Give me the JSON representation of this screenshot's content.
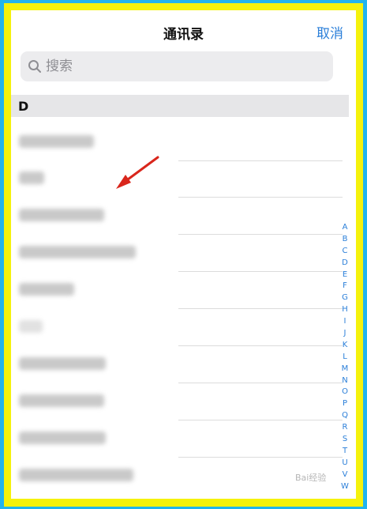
{
  "header": {
    "title": "通讯录",
    "cancel_label": "取消"
  },
  "search": {
    "placeholder": "搜索"
  },
  "section": {
    "letter": "D"
  },
  "contacts": [
    {
      "label": ""
    },
    {
      "label": ""
    },
    {
      "label": ""
    },
    {
      "label": ""
    },
    {
      "label": ""
    },
    {
      "label": ""
    },
    {
      "label": ""
    },
    {
      "label": ""
    },
    {
      "label": ""
    },
    {
      "label": ""
    }
  ],
  "index_letters": [
    "A",
    "B",
    "C",
    "D",
    "E",
    "F",
    "G",
    "H",
    "I",
    "J",
    "K",
    "L",
    "M",
    "N",
    "O",
    "P",
    "Q",
    "R",
    "S",
    "T",
    "U",
    "V",
    "W"
  ],
  "watermark": "Bai经验",
  "colors": {
    "frame_blue": "#22b4ee",
    "frame_yellow": "#f5f20c",
    "link_blue": "#2b7fd9",
    "arrow_red": "#d9261c"
  }
}
